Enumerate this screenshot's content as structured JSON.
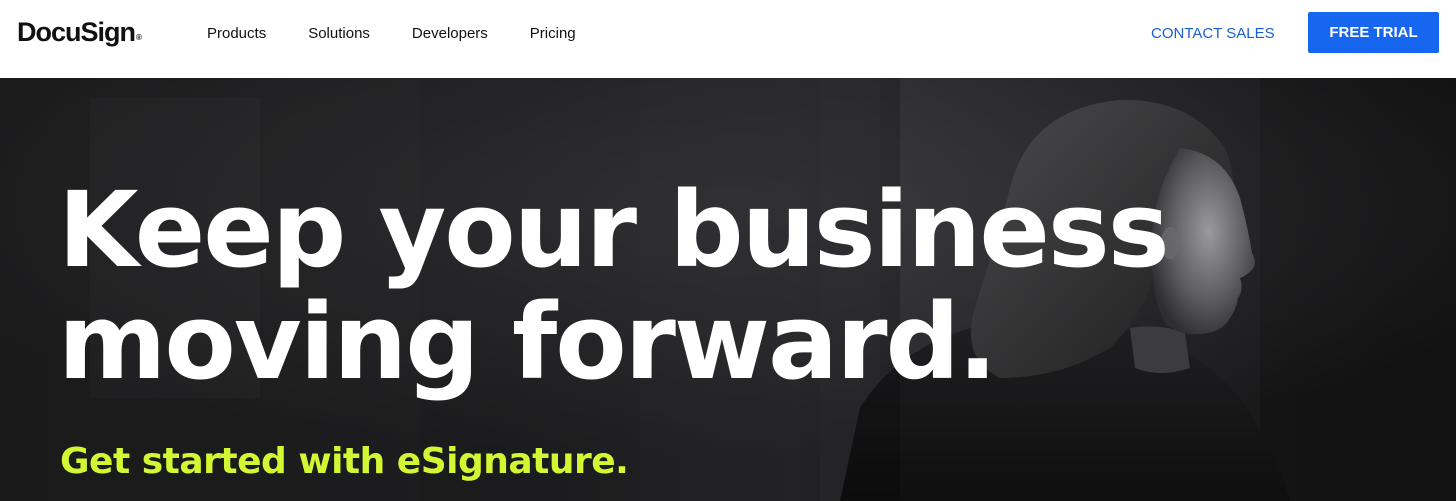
{
  "brand": {
    "logo_text": "DocuSign",
    "logo_mark": "®"
  },
  "nav": {
    "links": [
      {
        "label": "Products"
      },
      {
        "label": "Solutions"
      },
      {
        "label": "Developers"
      },
      {
        "label": "Pricing"
      }
    ],
    "contact_label": "CONTACT SALES",
    "trial_label": "FREE TRIAL"
  },
  "hero": {
    "headline_line1": "Keep your business",
    "headline_line2": "moving forward.",
    "subheadline": "Get started with eSignature.",
    "background_description_color": "#151516"
  },
  "colors": {
    "accent_blue": "#1766ef",
    "link_blue": "#1a5fd1",
    "highlight_lime": "#d4f733",
    "hero_background": "#151516"
  }
}
